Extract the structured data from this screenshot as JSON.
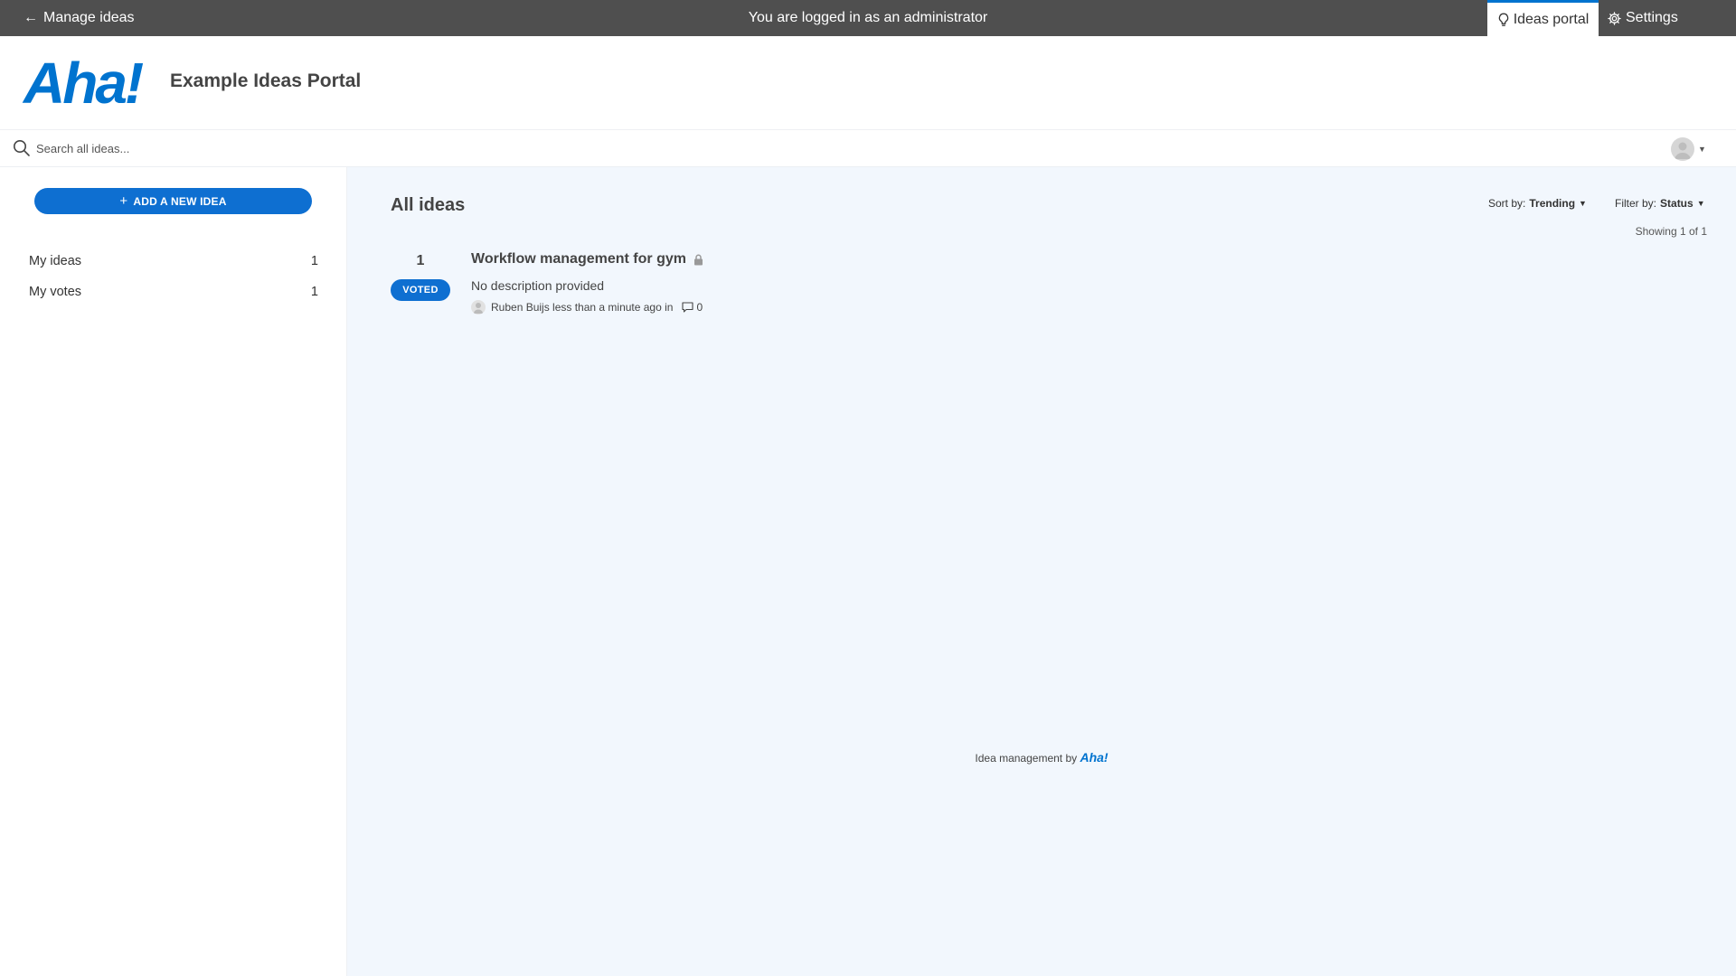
{
  "admin_bar": {
    "back_label": "Manage ideas",
    "notice": "You are logged in as an administrator",
    "portal_tab": "Ideas portal",
    "settings_tab": "Settings"
  },
  "header": {
    "logo": "Aha!",
    "portal_title": "Example Ideas Portal"
  },
  "search": {
    "placeholder": "Search all ideas..."
  },
  "sidebar": {
    "add_button": "ADD A NEW IDEA",
    "items": [
      {
        "label": "My ideas",
        "count": "1"
      },
      {
        "label": "My votes",
        "count": "1"
      }
    ]
  },
  "main": {
    "title": "All ideas",
    "sort_label": "Sort by:",
    "sort_value": "Trending",
    "filter_label": "Filter by:",
    "filter_value": "Status",
    "showing": "Showing 1 of 1"
  },
  "ideas": [
    {
      "votes": "1",
      "vote_status": "VOTED",
      "title": "Workflow management for gym",
      "description": "No description provided",
      "author_meta": "Ruben Buijs less than a minute ago in",
      "comment_count": "0"
    }
  ],
  "footer": {
    "text": "Idea management by",
    "logo": "Aha!"
  },
  "colors": {
    "accent": "#0e6fd1",
    "admin_bar": "#4f4f4f",
    "main_bg": "#f2f7fd"
  }
}
